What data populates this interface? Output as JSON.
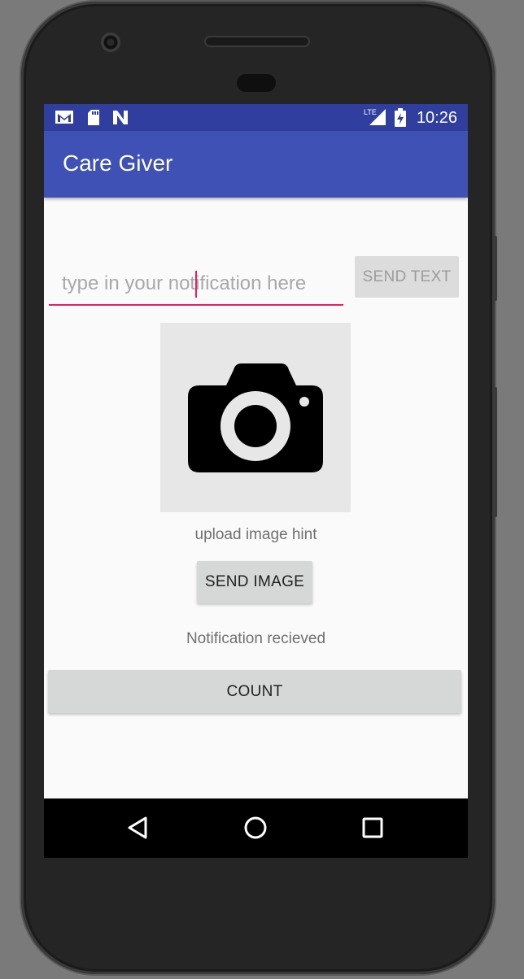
{
  "status_bar": {
    "time": "10:26",
    "left_icons": [
      "gmail-icon",
      "sd-card-icon",
      "n-icon"
    ],
    "right_icons": [
      "lte-signal-icon",
      "battery-charging-icon"
    ],
    "network_label": "LTE"
  },
  "app_bar": {
    "title": "Care Giver"
  },
  "form": {
    "notification_placeholder": "type in your notification here",
    "send_text_label": "SEND TEXT",
    "upload_hint": "upload image hint",
    "send_image_label": "SEND IMAGE",
    "notification_status": "Notification recieved",
    "count_label": "COUNT"
  },
  "nav_bar": {
    "buttons": [
      "back",
      "home",
      "recents"
    ]
  },
  "colors": {
    "status_bar": "#303f9f",
    "app_bar": "#3f51b5",
    "accent": "#e91e63",
    "button": "#d6d7d7"
  }
}
